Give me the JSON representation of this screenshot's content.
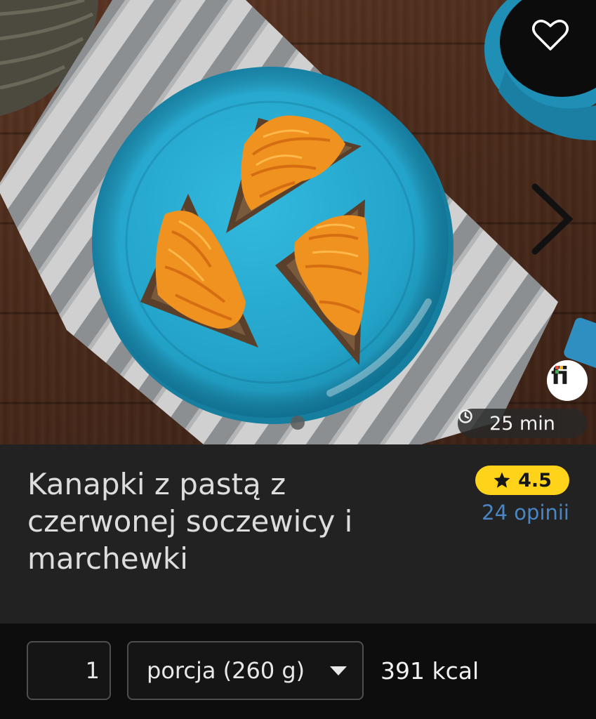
{
  "hero": {
    "favorite_icon": "heart-outline-icon",
    "next_icon": "chevron-right-icon",
    "source_logo_text": "fi",
    "time_icon": "clock-icon",
    "time_text": "25 min"
  },
  "recipe": {
    "title": "Kanapki z pastą z czerwonej soczewicy i marchewki",
    "rating": "4.5",
    "rating_icon": "star-icon",
    "reviews_text": "24 opinii"
  },
  "portion": {
    "quantity": "1",
    "unit_selected": "porcja (260 g)",
    "dropdown_icon": "caret-down-icon",
    "kcal_text": "391 kcal"
  },
  "colors": {
    "rating_badge": "#ffd31a",
    "link": "#4a86c4",
    "plate": "#27a9cf",
    "title_bg": "#222222"
  }
}
